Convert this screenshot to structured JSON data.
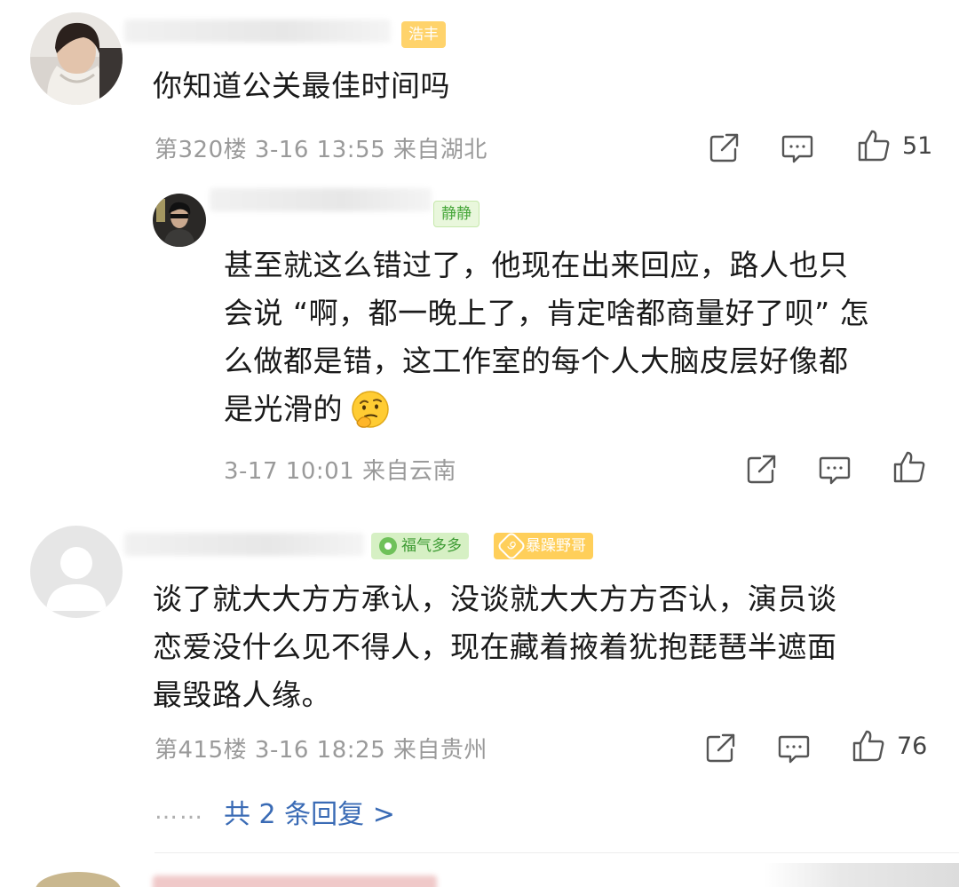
{
  "comments": [
    {
      "badge": "浩丰",
      "text": "你知道公关最佳时间吗",
      "floor": "第320楼",
      "date": "3-16 13:55",
      "location": "来自湖北",
      "likes": "51"
    },
    {
      "badge": "静静",
      "text_lines": [
        "甚至就这么错过了，他现在出来回应，路人也只",
        "会说 “啊，都一晚上了，肯定啥都商量好了呗” 怎",
        "么做都是错，这工作室的每个人大脑皮层好像都",
        "是光滑的"
      ],
      "date": "3-17 10:01",
      "location": "来自云南"
    },
    {
      "badge_1": "福气多多",
      "badge_2_level": "9",
      "badge_2": "暴躁野哥",
      "text_lines": [
        "谈了就大大方方承认，没谈就大大方方否认，演员谈",
        "恋爱没什么见不得人，现在藏着掖着犹抱琵琶半遮面",
        "最毁路人缘。"
      ],
      "floor": "第415楼",
      "date": "3-16 18:25",
      "location": "来自贵州",
      "likes": "76",
      "reply_dots": "……",
      "reply_link": "共 2 条回复 >"
    }
  ],
  "colors": {
    "accent_link": "#3a6bb5",
    "meta_gray": "#9a9a9a",
    "badge_orange": "#ffd36b",
    "badge_green": "#47a73a"
  },
  "icons": [
    "share-icon",
    "comment-icon",
    "like-icon",
    "thinking-emoji"
  ]
}
